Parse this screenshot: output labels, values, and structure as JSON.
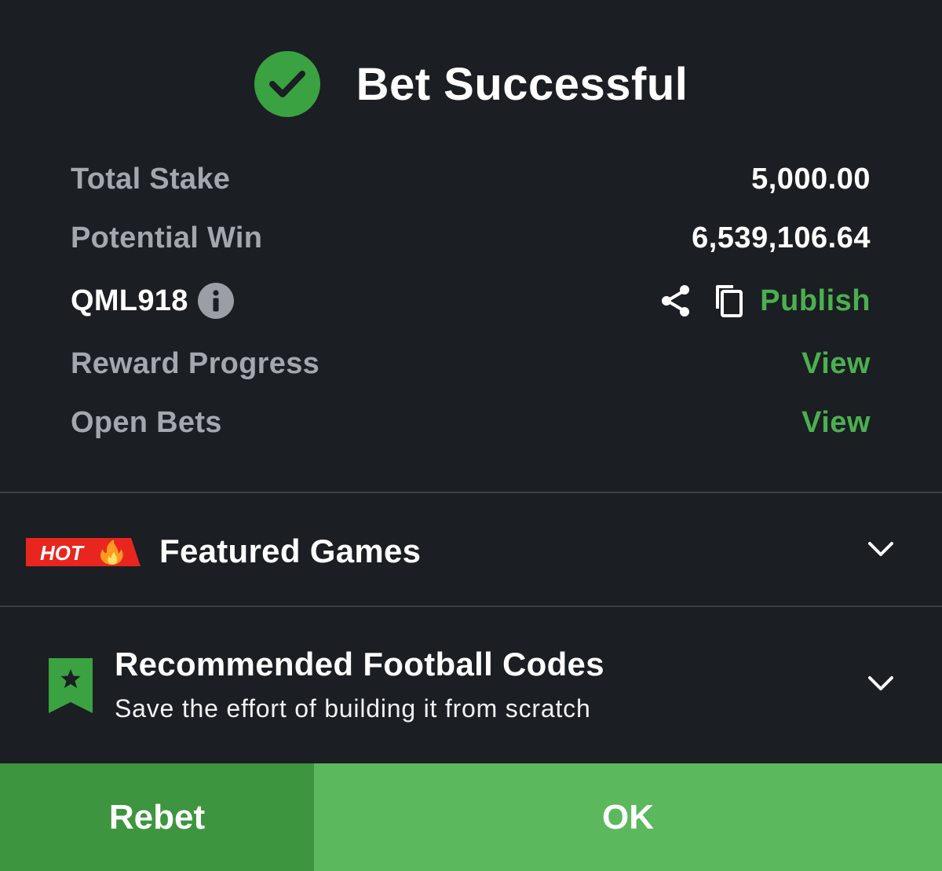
{
  "header": {
    "title": "Bet Successful",
    "icon": "check-circle-icon",
    "icon_color": "#3aa240"
  },
  "summary": {
    "total_stake_label": "Total Stake",
    "total_stake_value": "5,000.00",
    "potential_win_label": "Potential Win",
    "potential_win_value": "6,539,106.64",
    "booking_code": "QML918",
    "publish_label": "Publish",
    "reward_progress_label": "Reward Progress",
    "reward_progress_link": "View",
    "open_bets_label": "Open Bets",
    "open_bets_link": "View"
  },
  "featured": {
    "badge": "HOT",
    "title": "Featured Games"
  },
  "recommended": {
    "title": "Recommended Football Codes",
    "subtitle": "Save the effort of building it from scratch"
  },
  "buttons": {
    "rebet": "Rebet",
    "ok": "OK"
  },
  "colors": {
    "background": "#1b1e23",
    "accent_green": "#4bb04f",
    "rebet_bg": "#3e953f",
    "ok_bg": "#5bb85c",
    "hot_red": "#e8261f"
  }
}
